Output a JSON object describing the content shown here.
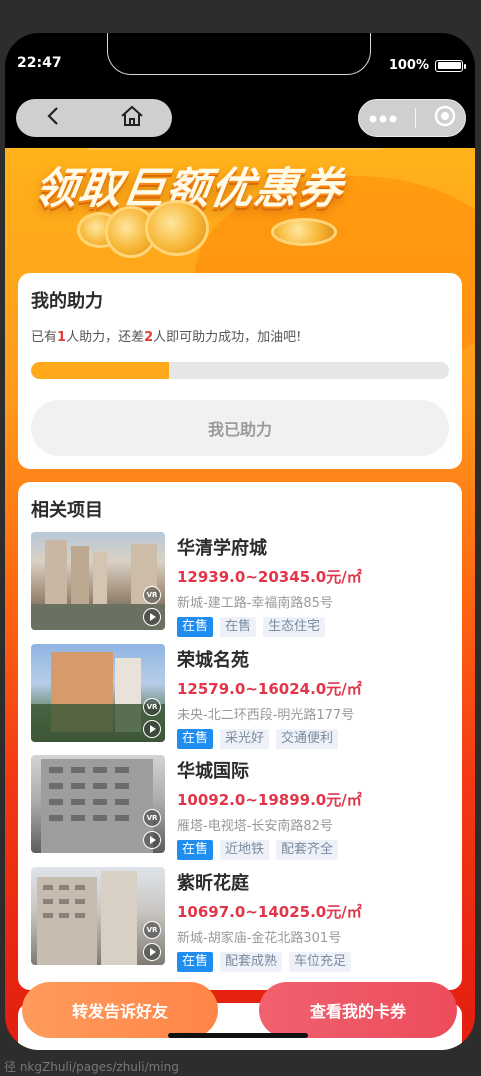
{
  "status": {
    "time": "22:47",
    "battery": "100%"
  },
  "banner": {
    "title": "领取巨额优惠券"
  },
  "assist": {
    "title": "我的助力",
    "text_prefix": "已有",
    "helped": "1",
    "text_mid": "人助力，还差",
    "remaining": "2",
    "text_suffix": "人即可助力成功，加油吧!",
    "progress": 0.33,
    "button": "我已助力"
  },
  "projects": {
    "title": "相关项目",
    "items": [
      {
        "name": "华清学府城",
        "price": "12939.0~20345.0元/㎡",
        "address": "新城-建工路-幸福南路85号",
        "tags": [
          "在售",
          "在售",
          "生态住宅"
        ]
      },
      {
        "name": "荣城名苑",
        "price": "12579.0~16024.0元/㎡",
        "address": "未央-北二环西段-明光路177号",
        "tags": [
          "在售",
          "采光好",
          "交通便利"
        ]
      },
      {
        "name": "华城国际",
        "price": "10092.0~19899.0元/㎡",
        "address": "雁塔-电视塔-长安南路82号",
        "tags": [
          "在售",
          "近地铁",
          "配套齐全"
        ]
      },
      {
        "name": "紫昕花庭",
        "price": "10697.0~14025.0元/㎡",
        "address": "新城-胡家庙-金花北路301号",
        "tags": [
          "在售",
          "配套成熟",
          "车位充足"
        ]
      }
    ]
  },
  "actions": {
    "share": "转发告诉好友",
    "my_cards": "查看我的卡券"
  },
  "footer": {
    "url": "径  nkgZhuli/pages/zhuli/ming"
  },
  "colors": {
    "accent_orange": "#ffa91a",
    "price_red": "#e2354a",
    "tag_blue": "#1f8cf0"
  }
}
